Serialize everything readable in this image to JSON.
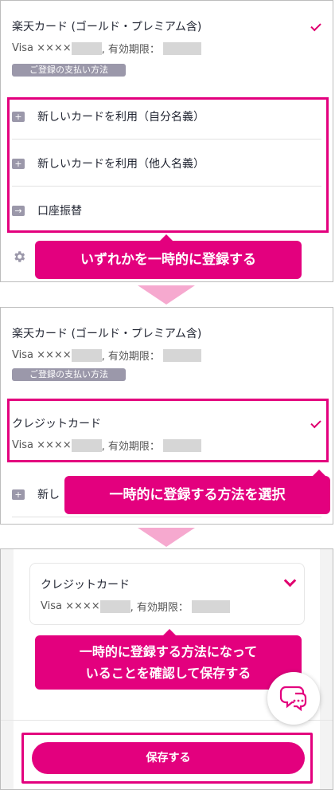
{
  "panel1": {
    "card_title": "楽天カード (ゴールド・プレミアム含)",
    "card_sub_prefix": "Visa ××××",
    "card_sub_expiry": ", 有効期限：",
    "badge": "ご登録の支払い方法",
    "options": [
      {
        "icon": "+",
        "label": "新しいカードを利用（自分名義）"
      },
      {
        "icon": "+",
        "label": "新しいカードを利用（他人名義）"
      },
      {
        "icon": "→",
        "label": "口座振替"
      }
    ],
    "callout": "いずれかを一時的に登録する"
  },
  "panel2": {
    "card_title": "楽天カード (ゴールド・プレミアム含)",
    "card_sub_prefix": "Visa ××××",
    "card_sub_expiry": ", 有効期限：",
    "badge": "ご登録の支払い方法",
    "selected_title": "クレジットカード",
    "selected_sub_prefix": "Visa ××××",
    "selected_sub_expiry": ", 有効期限：",
    "partial_option": "新し",
    "callout": "一時的に登録する方法を選択"
  },
  "panel3": {
    "card_title": "クレジットカード",
    "card_sub_prefix": "Visa ××××",
    "card_sub_expiry": ", 有効期限：",
    "callout_line1": "一時的に登録する方法になって",
    "callout_line2": "いることを確認して保存する",
    "save_label": "保存する"
  },
  "colors": {
    "accent": "#e3007e",
    "badge": "#9b98aa",
    "arrow": "#f6a9cf"
  }
}
